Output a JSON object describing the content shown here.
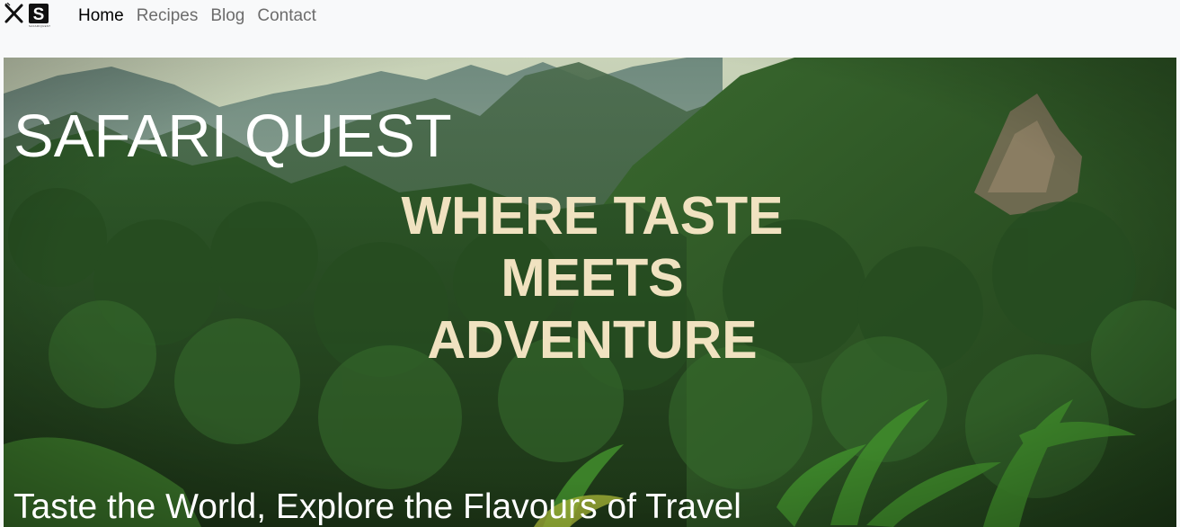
{
  "nav": {
    "logo": {
      "letter": "S",
      "subtitle": "SAFARIQUEST"
    },
    "links": [
      {
        "label": "Home",
        "active": true
      },
      {
        "label": "Recipes",
        "active": false
      },
      {
        "label": "Blog",
        "active": false
      },
      {
        "label": "Contact",
        "active": false
      }
    ]
  },
  "hero": {
    "brand": "SAFARI QUEST",
    "headline": [
      "WHERE TASTE",
      "MEETS",
      "ADVENTURE"
    ],
    "tagline": "Taste the World, Explore the Flavours of Travel"
  },
  "colors": {
    "navbar_bg": "#f8f9fa",
    "nav_active": "#000000",
    "nav_inactive": "#6c6c6c",
    "headline": "#f0e2c0",
    "hero_text": "#ffffff"
  }
}
